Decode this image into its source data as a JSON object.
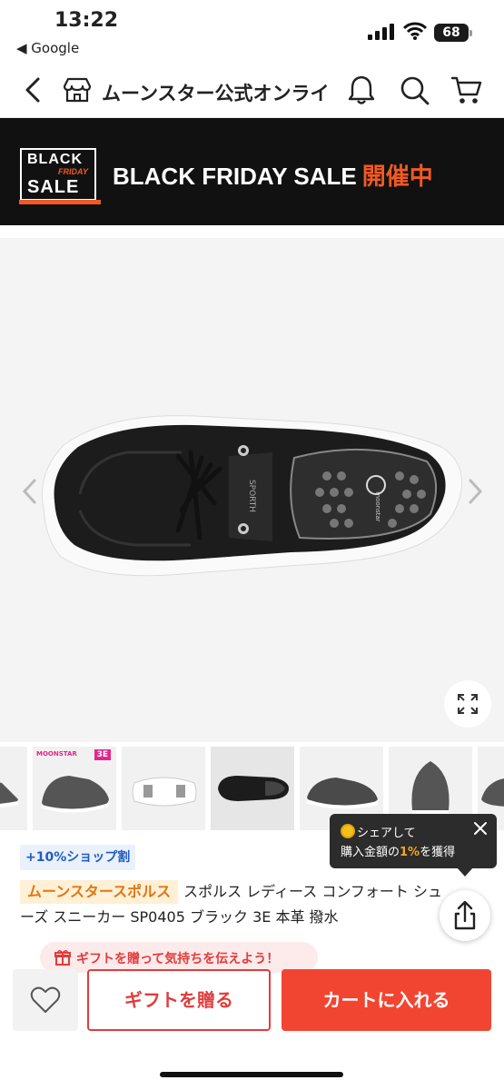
{
  "status_bar": {
    "time": "13:22",
    "back_app": "◀ Google",
    "battery": "68"
  },
  "header": {
    "title": "ムーンスター公式オンライ",
    "icons": [
      "chevron-left-icon",
      "store-icon",
      "bell-icon",
      "search-icon",
      "cart-icon"
    ]
  },
  "banner": {
    "badge_line1": "BLACK",
    "badge_line2": "FRIDAY",
    "badge_line3": "SALE",
    "text": "BLACK FRIDAY SALE",
    "highlight": "開催中",
    "accent_color": "#f05a24"
  },
  "product_image": {
    "print_label": "SPORTH",
    "insole_label": "moonstar"
  },
  "thumbnails": {
    "brand_logo": "MOONSTAR",
    "width_badge": "3E",
    "selected_index": 3,
    "count": 7
  },
  "tooltip": {
    "line1": "シェアして",
    "line2_prefix": "購入金額の",
    "line2_highlight": "1%",
    "line2_suffix": "を獲得"
  },
  "product": {
    "points_badge": "+10%ショップ割",
    "brand": "ムーンスタースポルス",
    "title": "スポルス レディース コンフォート シューズ スニーカー SP0405 ブラック 3E 本革 撥水"
  },
  "gift_prompt": "ギフトを贈って気持ちを伝えよう！",
  "actions": {
    "gift_button": "ギフトを贈る",
    "cart_button": "カートに入れる",
    "primary_color": "#f24531"
  }
}
